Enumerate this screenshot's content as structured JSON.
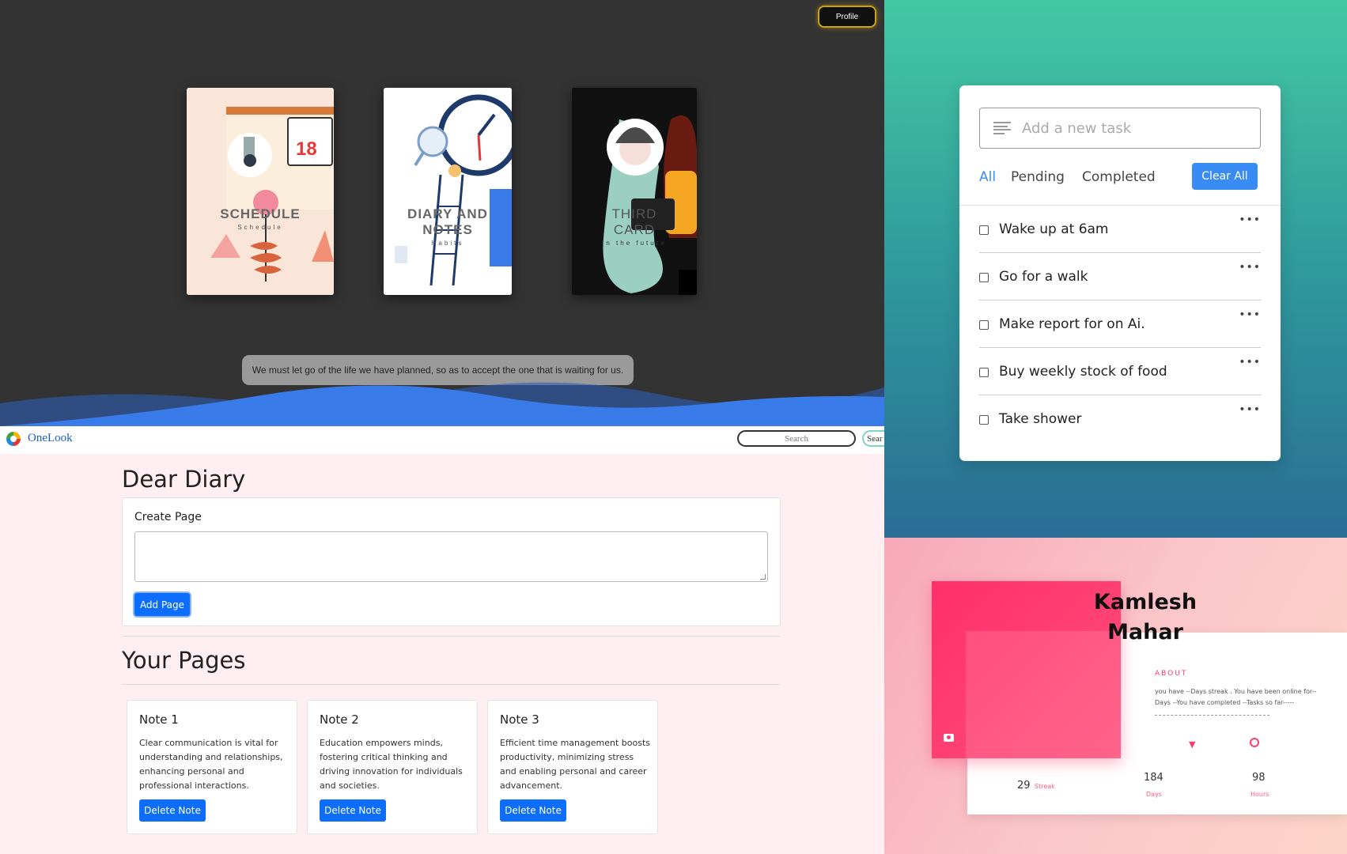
{
  "cards_panel": {
    "profile_button": "Profile",
    "cards": [
      {
        "title": "SCHEDULE",
        "subtitle": "Schedule"
      },
      {
        "title_line1": "DIARY AND",
        "title_line2": "NOTES",
        "subtitle": "Habits"
      },
      {
        "title_line1": "THIRD",
        "title_line2": "CARD",
        "subtitle": "In the future"
      }
    ],
    "calendar_day": "18",
    "quote": "We must let go of the life we have planned, so as to accept the one that is waiting for us.",
    "colors": {
      "background": "#333333",
      "wave": "#3a7bea"
    }
  },
  "todo": {
    "input_placeholder": "Add a new task",
    "filters": [
      "All",
      "Pending",
      "Completed"
    ],
    "active_filter": "All",
    "clear_button": "Clear All",
    "tasks": [
      {
        "label": "Wake up at 6am",
        "done": false
      },
      {
        "label": "Go for a walk",
        "done": false
      },
      {
        "label": "Make report for on Ai.",
        "done": false
      },
      {
        "label": "Buy weekly stock of food",
        "done": false
      },
      {
        "label": "Take shower",
        "done": false
      }
    ],
    "task_menu_icon": "ellipsis-icon",
    "colors": {
      "accent": "#3a8cf5",
      "gradient_top": "#44c8a3",
      "gradient_bottom": "#2a6d95"
    }
  },
  "diary": {
    "nav": {
      "brand": "OneLook",
      "search_placeholder": "Search",
      "search_button": "Sear"
    },
    "title": "Dear Diary",
    "create_label": "Create Page",
    "add_button": "Add Page",
    "pages_title": "Your Pages",
    "notes": [
      {
        "title": "Note 1",
        "body": "Clear communication is vital for understanding and relationships, enhancing personal and professional interactions.",
        "delete": "Delete Note"
      },
      {
        "title": "Note 2",
        "body": "Education empowers minds, fostering critical thinking and driving innovation for individuals and societies.",
        "delete": "Delete Note"
      },
      {
        "title": "Note 3",
        "body": "Efficient time management boosts productivity, minimizing stress and enabling personal and career advancement.",
        "delete": "Delete Note"
      }
    ],
    "colors": {
      "background": "#ffeef2",
      "button": "#0d6efd"
    }
  },
  "profile": {
    "name_line1": "Kamlesh",
    "name_line2": "Mahar",
    "about_heading": "ABOUT",
    "about_text": "you have --Days streak . You have been online for--Days --You have completed --Tasks so far-----",
    "stats": [
      {
        "value": "29",
        "label": "Streak"
      },
      {
        "value": "184",
        "label": "Days"
      },
      {
        "value": "98",
        "label": "Hours"
      }
    ],
    "colors": {
      "accent": "#ff3d6b"
    }
  }
}
